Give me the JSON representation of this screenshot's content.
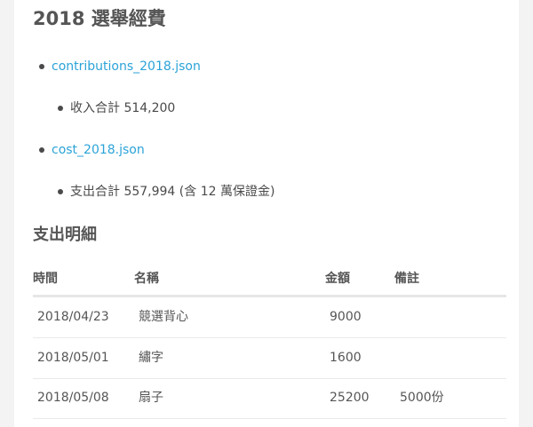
{
  "page": {
    "title": "2018 選舉經費",
    "files": [
      {
        "name": "contributions_2018.json",
        "summary": "收入合計 514,200"
      },
      {
        "name": "cost_2018.json",
        "summary": "支出合計 557,994 (含 12 萬保證金)"
      }
    ]
  },
  "section": {
    "title": "支出明細"
  },
  "table": {
    "headers": {
      "time": "時間",
      "name": "名稱",
      "amount": "金額",
      "note": "備註"
    },
    "rows": [
      {
        "time": "2018/04/23",
        "name": "競選背心",
        "amount": "9000",
        "note": ""
      },
      {
        "time": "2018/05/01",
        "name": "繡字",
        "amount": "1600",
        "note": ""
      },
      {
        "time": "2018/05/08",
        "name": "扇子",
        "amount": "25200",
        "note": "5000份"
      }
    ]
  },
  "colors": {
    "link": "#2ba3d8",
    "text": "#4a4a4a",
    "background": "#f3f3f3",
    "card": "#ffffff"
  }
}
